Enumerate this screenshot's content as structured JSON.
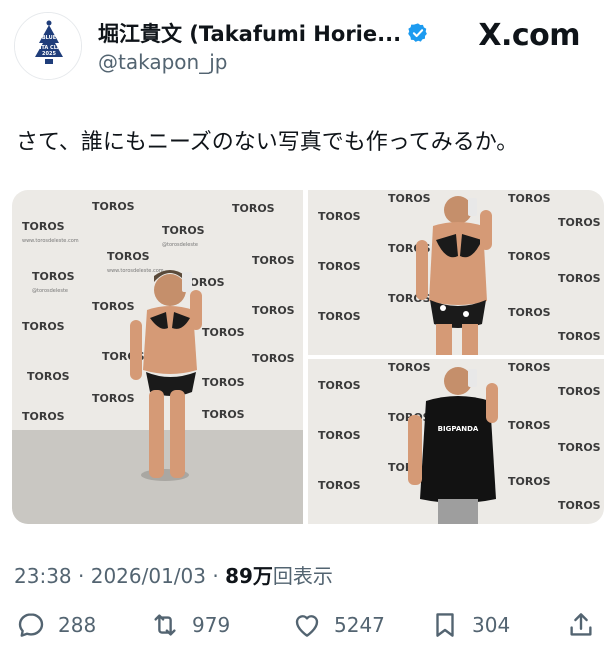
{
  "author": {
    "display_name": "堀江貴文 (Takafumi Horie...",
    "handle": "@takapon_jp",
    "avatar_text": "BLUE SANTA CLAUS 2025",
    "verified": true
  },
  "site": {
    "label": "X.com"
  },
  "tweet": {
    "text": "さて、誰にもニーズのない写真でも作ってみるか。"
  },
  "media": {
    "photo_count": 3,
    "backdrop_logo_text": "TOROS",
    "backdrop_url_text": "www.torosdeleste.com",
    "backdrop_handle_text": "@torosdeleste",
    "shirt_text": "BIGPANDA"
  },
  "meta": {
    "time": "23:38",
    "separator": "·",
    "date": "2026/01/03",
    "separator2": "·",
    "views": "89万",
    "views_label": "回表示"
  },
  "actions": {
    "replies": "288",
    "retweets": "979",
    "likes": "5247",
    "bookmarks": "304"
  },
  "colors": {
    "text": "#0f1419",
    "secondary": "#536471",
    "verified": "#1d9bf0"
  }
}
